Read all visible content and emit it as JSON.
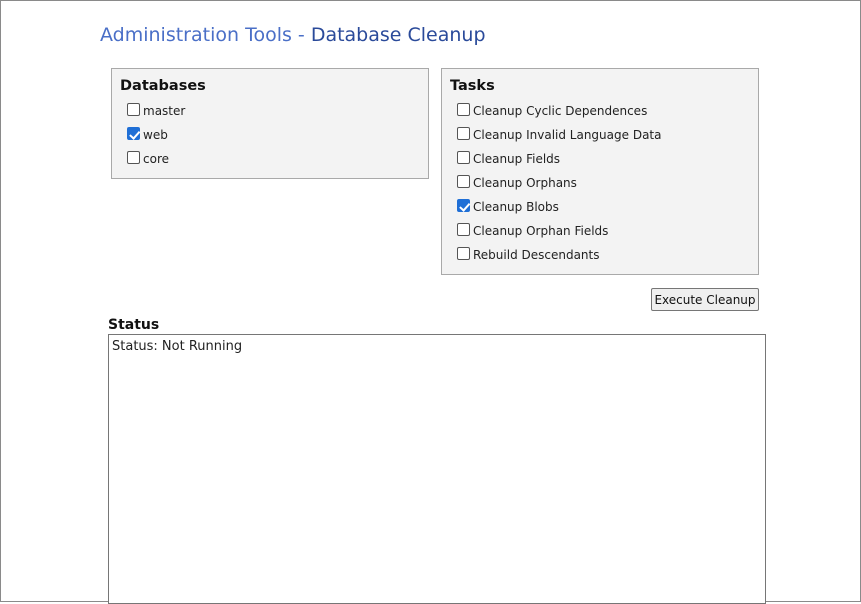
{
  "header": {
    "breadcrumb_link": "Administration Tools",
    "separator": " - ",
    "page_title": "Database Cleanup"
  },
  "databases": {
    "heading": "Databases",
    "items": [
      {
        "label": "master",
        "checked": false
      },
      {
        "label": "web",
        "checked": true
      },
      {
        "label": "core",
        "checked": false
      }
    ]
  },
  "tasks": {
    "heading": "Tasks",
    "items": [
      {
        "label": "Cleanup Cyclic Dependences",
        "checked": false
      },
      {
        "label": "Cleanup Invalid Language Data",
        "checked": false
      },
      {
        "label": "Cleanup Fields",
        "checked": false
      },
      {
        "label": "Cleanup Orphans",
        "checked": false
      },
      {
        "label": "Cleanup Blobs",
        "checked": true
      },
      {
        "label": "Cleanup Orphan Fields",
        "checked": false
      },
      {
        "label": "Rebuild Descendants",
        "checked": false
      }
    ]
  },
  "actions": {
    "execute_label": "Execute Cleanup"
  },
  "status": {
    "heading": "Status",
    "text": "Status: Not Running"
  },
  "colors": {
    "link": "#4a6fc7",
    "title": "#2a4a9a",
    "panel_bg": "#f3f3f3",
    "checkbox_checked": "#1f6fd6"
  }
}
